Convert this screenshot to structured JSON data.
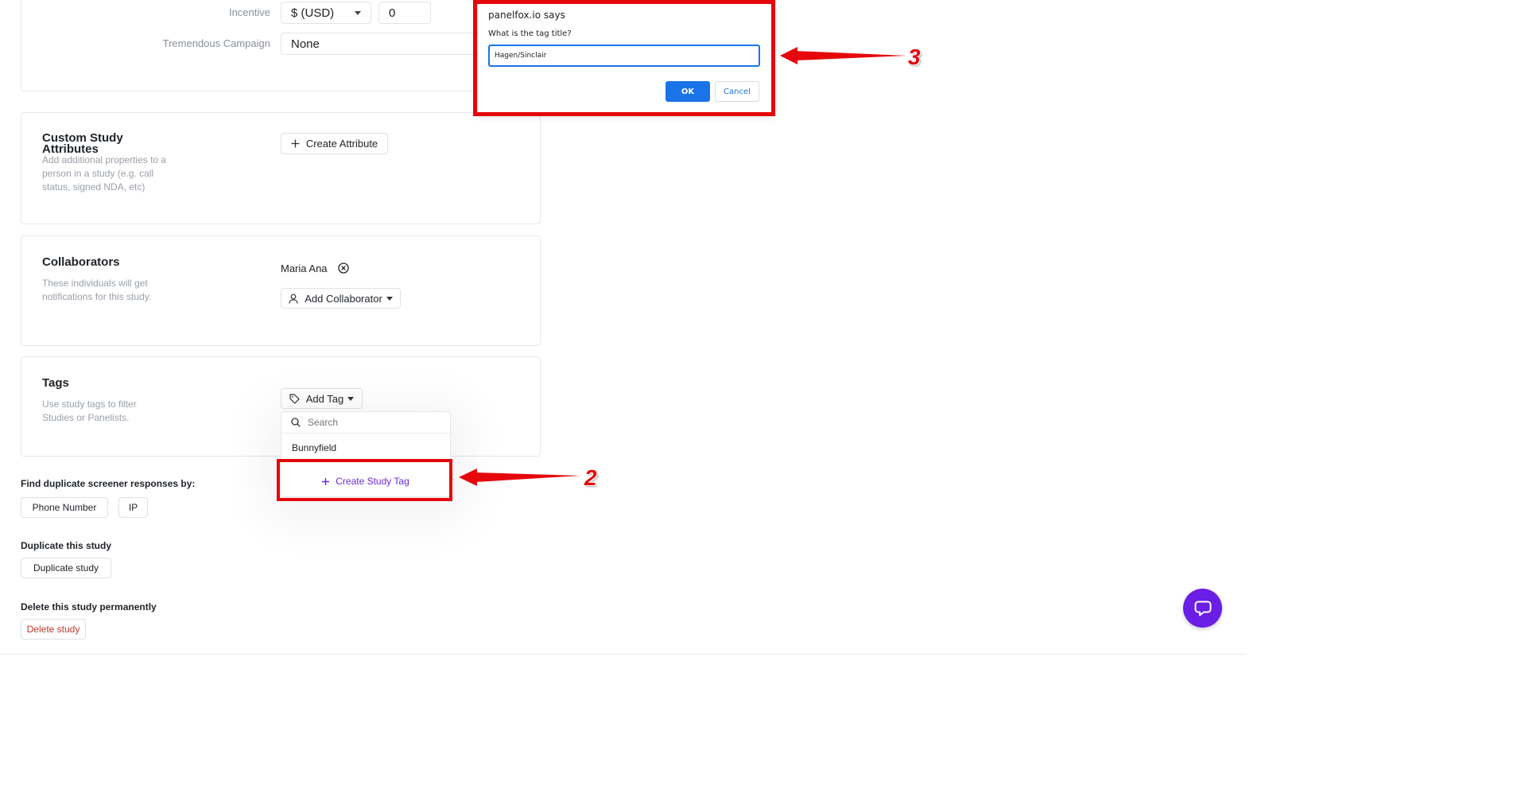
{
  "settings": {
    "incentive": {
      "label": "Incentive",
      "currency": "$ (USD)",
      "amount": "0"
    },
    "campaign": {
      "label": "Tremendous Campaign",
      "value": "None"
    }
  },
  "attributes": {
    "title": "Custom Study Attributes",
    "description": "Add additional properties to a person in a study (e.g. call status, signed NDA, etc)",
    "button_label": "Create Attribute"
  },
  "collaborators": {
    "title": "Collaborators",
    "description": "These individuals will get notifications for this study.",
    "people": [
      "Maria Ana"
    ],
    "button_label": "Add Collaborator"
  },
  "tags": {
    "title": "Tags",
    "description": "Use study tags to filter Studies or Panelists.",
    "button_label": "Add Tag",
    "dropdown": {
      "search_placeholder": "Search",
      "items": [
        "Bunnyfield"
      ],
      "create_label": "Create Study Tag"
    }
  },
  "duplicates": {
    "label": "Find duplicate screener responses by:",
    "options": [
      "Phone Number",
      "IP"
    ]
  },
  "duplicate_study": {
    "label": "Duplicate this study",
    "button_label": "Duplicate study"
  },
  "delete_study": {
    "label": "Delete this study permanently",
    "button_label": "Delete study"
  },
  "dialog": {
    "origin": "panelfox.io says",
    "prompt": "What is the tag title?",
    "value": "Hagen/Sinclair",
    "ok_label": "OK",
    "cancel_label": "Cancel"
  },
  "annotations": {
    "step_2": "2",
    "step_3": "3"
  },
  "colors": {
    "primary": "#1a73e8",
    "accent_purple": "#6d28d9",
    "fab": "#6a1ee6",
    "annotation_red": "#e5070b",
    "danger_text": "#c0392b"
  }
}
